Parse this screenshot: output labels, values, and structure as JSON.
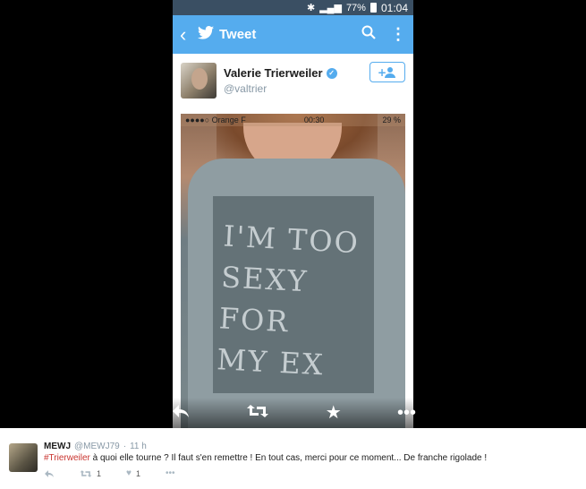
{
  "status_bar": {
    "battery": "77%",
    "time": "01:04"
  },
  "app_bar": {
    "title": "Tweet"
  },
  "tweet_card": {
    "display_name": "Valerie Trierweiler",
    "handle": "@valtrier"
  },
  "photo": {
    "status_left": "●●●●○ Orange F",
    "status_time": "00:30",
    "status_battery": "29 %",
    "shirt_text": [
      "I'M TOO",
      "SEXY FOR",
      "MY EX"
    ]
  },
  "reply_tweet": {
    "name": "MEWJ",
    "handle": "@MEWJ79",
    "time": "11 h",
    "hashtag": "#Trierweiler",
    "text": " à quoi elle tourne ? Il faut s'en remettre ! En tout cas, merci pour ce moment... De franche rigolade !",
    "retweets": "1",
    "favorites": "1"
  },
  "colors": {
    "twitter_blue": "#55acee",
    "status_bar": "#3a4f63",
    "hashtag": "#c9342f"
  }
}
